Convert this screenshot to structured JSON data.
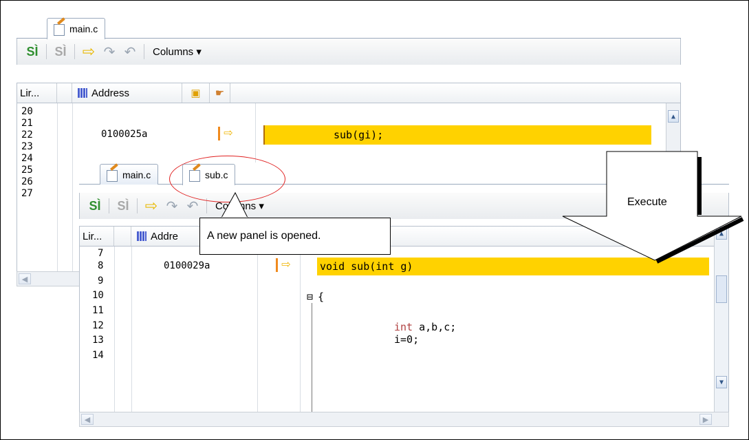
{
  "back_panel": {
    "tab_label": "main.c",
    "toolbar": {
      "columns_label": "Columns ▾"
    },
    "header": {
      "line_col": "Lir...",
      "address_col": "Address"
    },
    "line_numbers": [
      "20",
      "21",
      "22",
      "23",
      "24",
      "25",
      "26",
      "27"
    ],
    "current_address": "0100025a",
    "current_code": "sub(gi);"
  },
  "front_panel": {
    "tabs": [
      {
        "label": "main.c",
        "active": false
      },
      {
        "label": "sub.c",
        "active": true
      }
    ],
    "toolbar": {
      "columns_label": "Columns ▾"
    },
    "header": {
      "line_col": "Lir...",
      "address_col": "Addre"
    },
    "line_numbers": [
      "7",
      "8",
      "9",
      "10",
      "11",
      "12",
      "13",
      "14"
    ],
    "current_address": "0100029a",
    "code": {
      "line8": "void sub(int g)",
      "line10": "{",
      "line12_kw": "int",
      "line12_rest": " a,b,c;",
      "line13": "i=0;"
    }
  },
  "annotations": {
    "callout": "A new panel is opened.",
    "execute": "Execute",
    "highlight_color": "#ffd200",
    "ellipse_color": "#e02020"
  }
}
